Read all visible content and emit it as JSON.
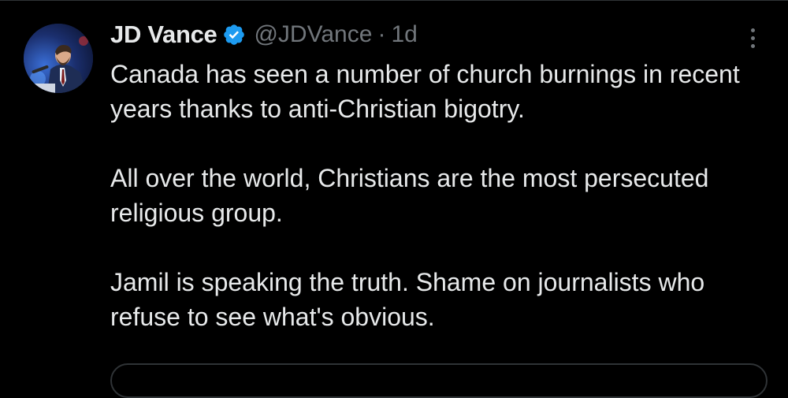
{
  "tweet": {
    "author": {
      "display_name": "JD Vance",
      "handle": "@JDVance",
      "verified": true,
      "verified_color": "#1d9bf0"
    },
    "separator": "·",
    "time": "1d",
    "paragraphs": [
      "Canada has seen a number of church burnings in recent years thanks to anti-Christian bigotry.",
      "All over the world, Christians are the most persecuted religious group.",
      "Jamil is speaking the truth. Shame on journalists who refuse to see what's obvious."
    ],
    "icons": {
      "avatar": "profile-photo",
      "verified": "verified-badge-icon",
      "more": "more-vertical-icon"
    }
  },
  "colors": {
    "background": "#000000",
    "text_primary": "#e7e9ea",
    "text_secondary": "#71767b",
    "border": "#2f3336"
  }
}
